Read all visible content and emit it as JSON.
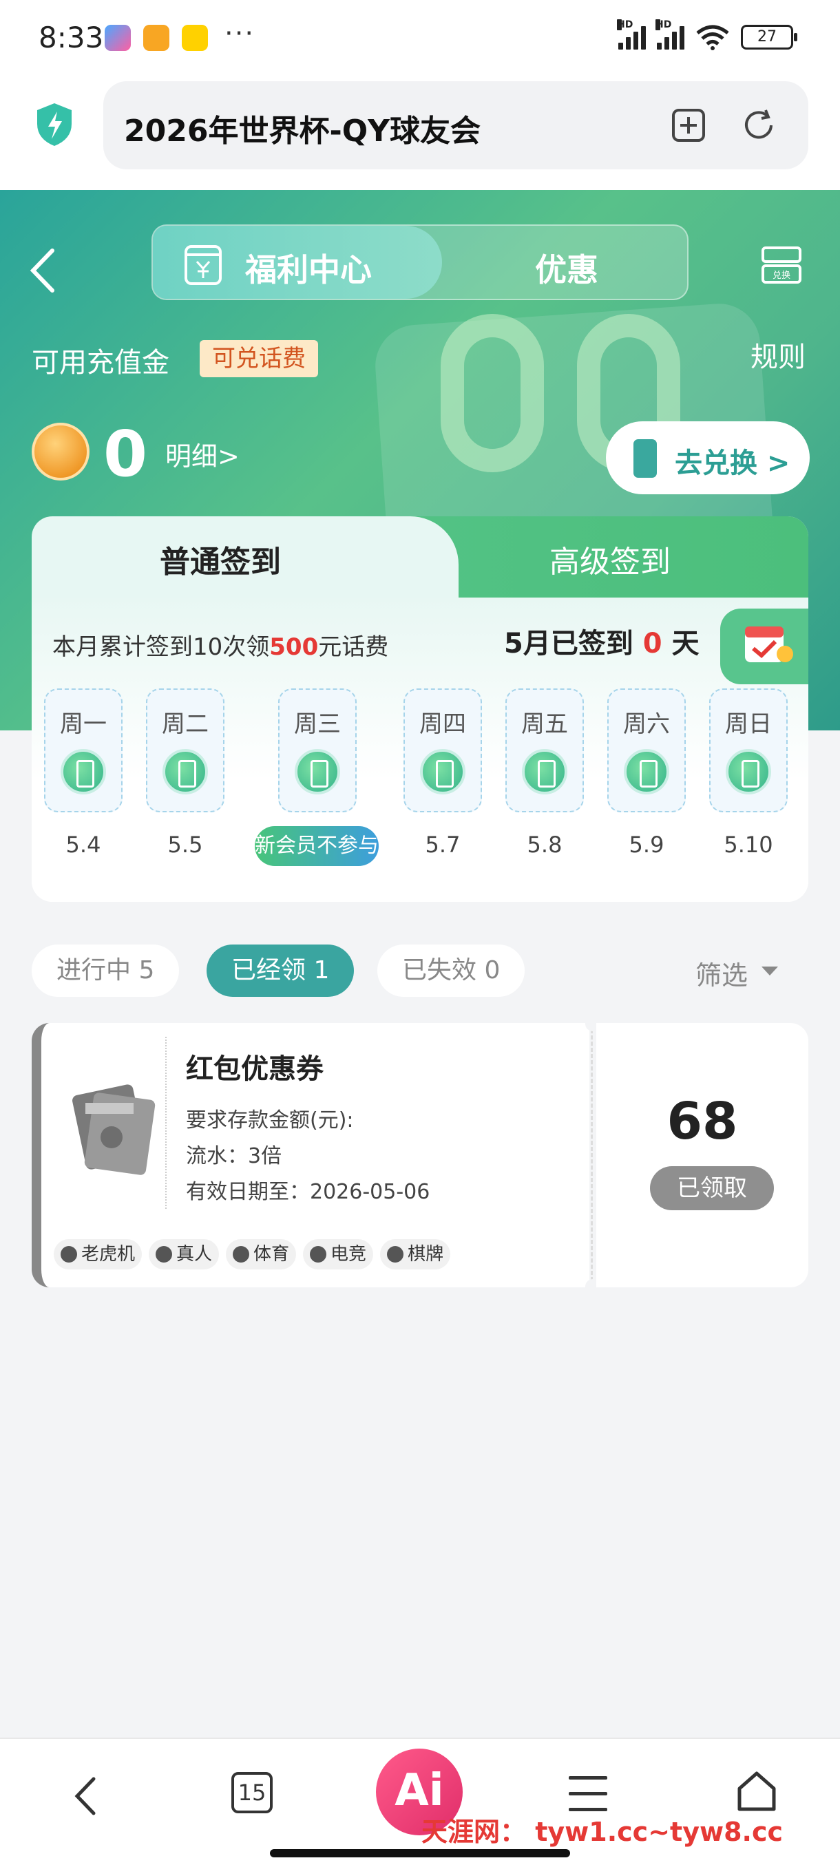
{
  "status_bar": {
    "time": "8:33",
    "battery": "27"
  },
  "browser": {
    "page_title": "2026年世界杯-QY球友会"
  },
  "header": {
    "tab_welfare": "福利中心",
    "tab_offers": "优惠",
    "exchange_icon_label": "兑换"
  },
  "balance": {
    "label": "可用充值金",
    "badge": "可兑话费",
    "rules": "规则",
    "value": "0",
    "detail_link": "明细>",
    "exchange_button": "去兑换 >"
  },
  "signin": {
    "tab_normal": "普通签到",
    "tab_advanced": "高级签到",
    "tip_prefix": "本月累计签到10次领",
    "tip_amount": "500",
    "tip_suffix": "元话费",
    "signed_prefix": "5月已签到",
    "signed_count": "0",
    "signed_suffix": "天",
    "days": [
      {
        "name": "周一",
        "date": "5.4"
      },
      {
        "name": "周二",
        "date": "5.5"
      },
      {
        "name": "周三",
        "date": ""
      },
      {
        "name": "周四",
        "date": "5.7"
      },
      {
        "name": "周五",
        "date": "5.8"
      },
      {
        "name": "周六",
        "date": "5.9"
      },
      {
        "name": "周日",
        "date": "5.10"
      }
    ],
    "new_member_badge": "新会员不参与"
  },
  "filters": {
    "in_progress": "进行中  5",
    "claimed": "已经领  1",
    "expired": "已失效  0",
    "filter": "筛选"
  },
  "coupon": {
    "title": "红包优惠券",
    "requirement": "要求存款金额(元):",
    "turnover": "流水：3倍",
    "valid_until": "有效日期至：2026-05-06",
    "amount": "68",
    "status": "已领取",
    "tags": [
      "老虎机",
      "真人",
      "体育",
      "电竞",
      "棋牌"
    ]
  },
  "bottom_nav": {
    "tabs_count": "15",
    "ai_label": "Ai",
    "watermark": "天涯网：  tyw1.cc~tyw8.cc"
  },
  "colors": {
    "accent": "#3aa5a0",
    "hero_green": "#58c18a",
    "highlight_red": "#e53935"
  }
}
